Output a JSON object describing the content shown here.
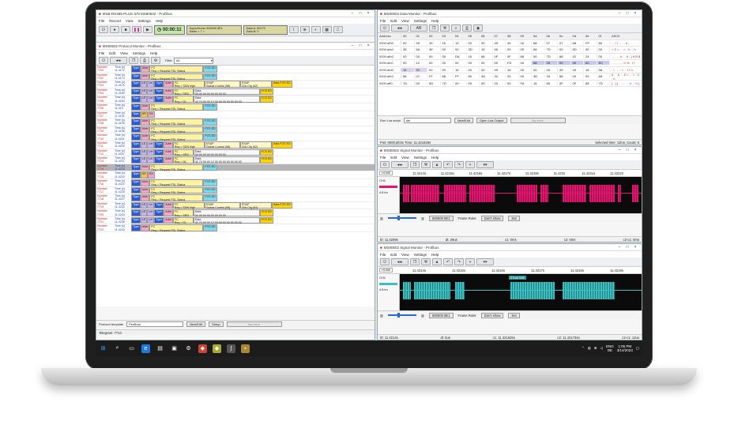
{
  "protocol_window": {
    "title": "MSB-RS485-PLUS S/N MS80502 - Profibus",
    "menu": [
      "File",
      "Record",
      "View",
      "Settings",
      "Help"
    ],
    "timer": "00:00:11",
    "status_line1": "Asynchronic 500000 8E1",
    "status_line2": "Meter < 7 >",
    "data_a": "Data A: 60170",
    "data_b": "Data B: 0",
    "monitor_title": "MS80502 Protocol Monitor - Profibus",
    "monitor_menu": [
      "File",
      "Edit",
      "View",
      "Settings",
      "Help"
    ],
    "filter_label": "Filter",
    "filter_value": "All",
    "rows": [
      {
        "num": "7703",
        "time": "11.4172",
        "kind": "short",
        "fc": "Req = Request FDL Status",
        "fcs": "FCS ED"
      },
      {
        "num": "7702",
        "time": "11.4174",
        "kind": "short",
        "fc": "Req = Request FDL Status",
        "fcs": "FCS ED"
      },
      {
        "num": "7703",
        "time": "11.4176",
        "kind": "long",
        "fc": "Req = SDN high",
        "dsap": "Global Control (58)",
        "ssap": "Chk Cfg (62)",
        "fcs": "Data FCS ED"
      },
      {
        "num": "7704",
        "time": "11.4180",
        "kind": "data",
        "fc": "Req = SRD high",
        "data": "00 00 00 00 00 00 00 00",
        "fcs": "FCS ED"
      },
      {
        "num": "7705",
        "time": "11.4184",
        "kind": "data",
        "fc": "Req = DL",
        "data": "42 74 00 00 12 00 00 00 00 00 00 00",
        "fcs": "FCS ED"
      },
      {
        "num": "7706",
        "time": "11.419",
        "kind": "short",
        "fc": "Req = Request FDL Status",
        "fcs": "FCS ED"
      },
      {
        "num": "7707",
        "time": "11.4191",
        "kind": "sd",
        "fc": "",
        "fcs": ""
      },
      {
        "num": "7708",
        "time": "11.4196",
        "kind": "short",
        "fc": "Req = Request FDL Status",
        "fcs": "FCS ED"
      },
      {
        "num": "7709",
        "time": "11.4198",
        "kind": "short",
        "fc": "Req = Request FDL Status",
        "fcs": "FCS ED"
      },
      {
        "num": "7710",
        "time": "11.4201",
        "kind": "short",
        "fc": "Req = Request FDL Status",
        "fcs": "FCS ED"
      },
      {
        "num": "7711",
        "time": "11.4203",
        "kind": "long",
        "fc": "Req = SDN high",
        "dsap": "Global Control (58)",
        "ssap": "Chk Cfg (62)",
        "fcs": "Data FCS ED"
      },
      {
        "num": "7712",
        "time": "11.4207",
        "kind": "data",
        "fc": "Req = SRD high",
        "data": "00 00 00 00 00 00 00 00",
        "fcs": "FCS ED"
      },
      {
        "num": "7713",
        "time": "11.4211",
        "kind": "data",
        "fc": "Req = DL",
        "data": "42 74 00 00 12 00 00 00 00 00 00 00",
        "fcs": "FCS ED"
      },
      {
        "num": "7714",
        "time": "11.4216",
        "kind": "short",
        "fc": "Req = Request FDL Status",
        "fcs": "FCS ED",
        "selected": true
      },
      {
        "num": "7715",
        "time": "11.4220",
        "kind": "sd",
        "fc": "",
        "fcs": ""
      },
      {
        "num": "7716",
        "time": "11.4222",
        "kind": "short",
        "fc": "Req = Request FDL Status",
        "fcs": "FCS ED"
      },
      {
        "num": "7717",
        "time": "11.4225",
        "kind": "short",
        "fc": "Req = Request FDL Status",
        "fcs": "FCS ED"
      },
      {
        "num": "7718",
        "time": "11.4227",
        "kind": "short",
        "fc": "Req = Request FDL Status",
        "fcs": "FCS ED"
      },
      {
        "num": "7719",
        "time": "11.4230",
        "kind": "long",
        "fc": "Req = SDN high",
        "dsap": "Global Control (58)",
        "ssap": "Chk Cfg (62)",
        "fcs": "Data FCS ED"
      },
      {
        "num": "7720",
        "time": "11.4234",
        "kind": "data",
        "fc": "Req = SRD high",
        "data": "00 00 00 00 00 00 00 00",
        "fcs": "FCS ED"
      },
      {
        "num": "7721",
        "time": "11.4238",
        "kind": "data",
        "fc": "Req = DL",
        "data": "42 74 00 00 12 00 00 00 00 00 00 00",
        "fcs": "FCS ED"
      },
      {
        "num": "7722",
        "time": "11.4243",
        "kind": "short",
        "fc": "Req = Request FDL Status",
        "fcs": "FCS ED"
      }
    ],
    "template_label": "Protocol template",
    "template_value": "Profibus",
    "buttons": [
      "New/Edit",
      "Setup",
      "No error"
    ],
    "telegram": "Telegram: 7714"
  },
  "data_window": {
    "title": "MS80502 Data Monitor - Profibus",
    "menu": [
      "File",
      "Edit",
      "View",
      "Settings",
      "Help"
    ],
    "headers": [
      "Address",
      "00",
      "01",
      "02",
      "03",
      "04",
      "05",
      "06",
      "07",
      "08",
      "09",
      "0a",
      "0b",
      "0c",
      "0d",
      "0e",
      "0f",
      "ASCII"
    ],
    "rows": [
      {
        "addr": "0000:af90",
        "vals": [
          "00",
          "49",
          "49",
          "16",
          "13",
          "00",
          "00",
          "49",
          "49",
          "16",
          "68",
          "07",
          "07",
          "68",
          "FF",
          "80"
        ],
        "ascii": ". . I I . . . . h . ."
      },
      {
        "addr": "0000:afa0",
        "vals": [
          "3E",
          "5A",
          "3E",
          "00",
          "00",
          "3D",
          "16",
          "68",
          "09",
          "09",
          "68",
          "7D",
          "00",
          "5D",
          "00",
          "00"
        ],
        "ascii": "> Z > . . = . h . . h"
      },
      {
        "addr": "0000:afb0",
        "vals": [
          "00",
          "00",
          "00",
          "00",
          "DA",
          "16",
          "68",
          "0F",
          "0F",
          "68",
          "00",
          "7D",
          "68",
          "42",
          "24",
          "00"
        ],
        "ascii": ". . . . . h . . h . } h B $"
      },
      {
        "addr": "0000:afc0",
        "vals": [
          "00",
          "12",
          "00",
          "00",
          "00",
          "00",
          "00",
          "00",
          "FD",
          "16",
          "68",
          "25",
          "00",
          "49",
          "6C",
          "EC"
        ],
        "ascii": ". . . . . . . h % . I l"
      },
      {
        "addr": "0000:afd0",
        "vals": [
          "16",
          "5C",
          "00",
          "00",
          "16",
          "00",
          "00",
          "49",
          "16",
          "16",
          "00",
          "00",
          "49",
          "49",
          "16",
          "68"
        ],
        "ascii": ". \\ . . . . I . . I I h"
      },
      {
        "addr": "0000:afe0",
        "vals": [
          "68",
          "07",
          "07",
          "68",
          "FF",
          "80",
          "5A",
          "3C",
          "00",
          "00",
          "3D",
          "16",
          "68",
          "09",
          "09",
          "68"
        ],
        "ascii": "h . . h . . Z < . . = . h . . h"
      },
      {
        "addr": "0000:aff0",
        "vals": [
          "7D",
          "00",
          "5D",
          "7D",
          "00",
          "00",
          "00",
          "00",
          "00",
          "FA",
          "16",
          "68",
          "0F",
          "0F",
          "68",
          "7D"
        ],
        "ascii": "} . ] } . . . . . . h . . h }"
      }
    ],
    "run_label": "Run Lua script",
    "run_value": "dle",
    "run_buttons": [
      "New/Edit",
      "Open Lua Output",
      "No error"
    ],
    "status_left": "Pos: 0000:afc0x Time: 11.421626s",
    "status_right": "Selected time: 11fus, Count: 6"
  },
  "signal_window_1": {
    "title": "MS80502 Signal Monitor - Profibus",
    "menu": [
      "File",
      "Edit",
      "View",
      "Settings",
      "Help"
    ],
    "home": "HOME",
    "ticks": [
      "11.4214s",
      "11.4215s",
      "11.4216s",
      "11.4217s",
      "11.4218s",
      "11.422s",
      "11.4221s",
      "11.4222s"
    ],
    "channel": "CH1",
    "channel_options": "A B Inv",
    "baud": "500000 8E1",
    "frame_ruler_label": "Frame Ruler",
    "frame_ruler_value": "Don't show",
    "set_label": "Set",
    "status": [
      "t0: 11.4209s",
      "dt: 29us",
      "c1: 0ms",
      "c2: 0ms",
      "c2-c1: 0ms"
    ]
  },
  "signal_window_2": {
    "title": "MS80502 Signal Monitor - Profibus",
    "menu": [
      "File",
      "Edit",
      "View",
      "Settings",
      "Help"
    ],
    "home": "HOME",
    "ticks": [
      "11.4214s",
      "11.4215s",
      "11.4216s",
      "11.4217s",
      "11.4218s",
      "11.4219s"
    ],
    "channel": "CH1",
    "channel_options": "A B Inv",
    "overlay": "27ms S/N",
    "baud": "500000 8E1",
    "frame_ruler_label": "Frame Ruler",
    "frame_ruler_value": "Don't show",
    "set_label": "Set",
    "status": [
      "t0: 11.4214s",
      "dt: 5us",
      "c1: 11.421625s",
      "c2: 11.421734s",
      "c2-c1: 12us"
    ]
  },
  "taskbar": {
    "lang": "ENG",
    "region": "DE",
    "time": "1:05 PM",
    "date": "3/14/2023",
    "colors": {
      "bg": "#1c1c1c"
    }
  },
  "colors": {
    "signal_pink": "#e0156e",
    "signal_cyan": "#3bbfc0"
  }
}
